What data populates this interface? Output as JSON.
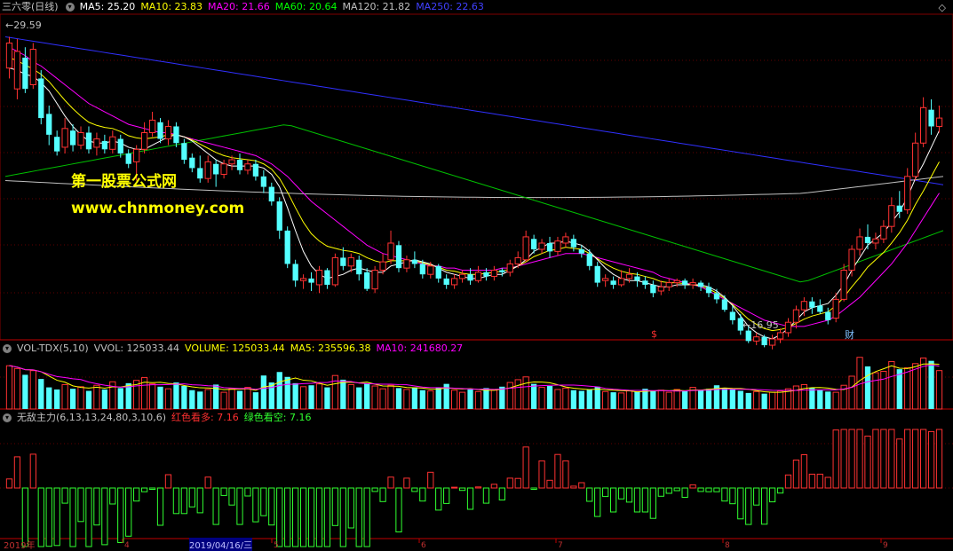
{
  "header": {
    "stock_title": "三六零(日线)",
    "ma5": "MA5: 25.20",
    "ma10": "MA10: 23.83",
    "ma20": "MA20: 21.66",
    "ma60": "MA60: 20.64",
    "ma120": "MA120: 21.82",
    "ma250": "MA250: 22.63",
    "colors": {
      "ma5": "#ffffff",
      "ma10": "#ffff00",
      "ma20": "#ff00ff",
      "ma60": "#00ff00",
      "ma120": "#c0c0c0",
      "ma250": "#4040ff"
    }
  },
  "price_panel": {
    "high_label": "29.59",
    "low_label": "16.95",
    "watermark_title": "第一股票公式网",
    "watermark_url": "www.chnmoney.com",
    "marker_s": "$",
    "marker_cai": "财",
    "corner_icon": "diamond-icon"
  },
  "volume_panel": {
    "title": "VOL-TDX(5,10)",
    "vvol": "VVOL: 125033.44",
    "volume": "VOLUME: 125033.44",
    "ma5": "MA5: 235596.38",
    "ma10": "MA10: 241680.27"
  },
  "indicator_panel": {
    "title": "无敌主力(6,13,13,24,80,3,10,6)",
    "red_label": "红色看多: 7.16",
    "green_label": "绿色看空: 7.16"
  },
  "date_axis": {
    "year_label": "2019年",
    "cursor_date": "2019/04/16/三",
    "ticks": [
      "4",
      "5",
      "6",
      "7",
      "8",
      "9"
    ]
  },
  "chart_data": {
    "type": "candlestick",
    "price_range": [
      15,
      30.5
    ],
    "candles": [
      [
        28,
        29.2,
        29.5,
        27.5
      ],
      [
        27,
        28.8,
        29.4,
        26.5
      ],
      [
        28.5,
        27,
        29,
        26.8
      ],
      [
        27.2,
        28.9,
        29.2,
        27
      ],
      [
        27.5,
        25.6,
        27.9,
        25.3
      ],
      [
        25.8,
        24.8,
        26.2,
        24.3
      ],
      [
        24.7,
        24,
        25,
        23.8
      ],
      [
        24.2,
        25.1,
        25.6,
        23.9
      ],
      [
        25,
        24.3,
        25.3,
        24
      ],
      [
        24.3,
        24.9,
        25.2,
        24.1
      ],
      [
        24.9,
        24.1,
        25.2,
        23.9
      ],
      [
        24.2,
        24.6,
        24.9,
        23.8
      ],
      [
        24.5,
        24.1,
        24.8,
        23.9
      ],
      [
        24.1,
        24.7,
        25,
        23.9
      ],
      [
        24.6,
        23.9,
        24.8,
        23.7
      ],
      [
        23.9,
        23.4,
        24.1,
        23.2
      ],
      [
        23.5,
        24.1,
        24.3,
        22.6
      ],
      [
        24.1,
        24.9,
        25.4,
        23.9
      ],
      [
        24.9,
        25.5,
        25.9,
        24.7
      ],
      [
        25.4,
        24.6,
        25.6,
        24.4
      ],
      [
        24.6,
        25.2,
        25.5,
        24.3
      ],
      [
        25.2,
        24.4,
        25.4,
        24.2
      ],
      [
        24.4,
        23.6,
        24.6,
        23.4
      ],
      [
        23.7,
        23.2,
        23.9,
        23
      ],
      [
        23.2,
        22.7,
        23.8,
        22.5
      ],
      [
        22.7,
        23.5,
        23.8,
        22.5
      ],
      [
        23.4,
        22.9,
        23.6,
        22.3
      ],
      [
        22.9,
        23.4,
        23.6,
        22.7
      ],
      [
        23.4,
        23.6,
        23.8,
        23.1
      ],
      [
        23.6,
        23.1,
        23.9,
        22.9
      ],
      [
        23.1,
        23.4,
        23.6,
        22.9
      ],
      [
        23.4,
        22.8,
        23.6,
        22.6
      ],
      [
        22.8,
        22.3,
        23.1,
        22
      ],
      [
        22.3,
        21.6,
        22.5,
        21.4
      ],
      [
        21.6,
        20.2,
        21.8,
        19.8
      ],
      [
        20.2,
        18.6,
        20.4,
        18.4
      ],
      [
        18.6,
        17.8,
        18.8,
        17.5
      ],
      [
        17.8,
        17.9,
        18.1,
        17.4
      ],
      [
        17.9,
        17.7,
        18.2,
        17.3
      ],
      [
        17.6,
        18.3,
        18.5,
        17.2
      ],
      [
        18.3,
        17.6,
        18.4,
        17.4
      ],
      [
        17.6,
        18.9,
        19.1,
        17.5
      ],
      [
        18.9,
        18.5,
        19.4,
        18.3
      ],
      [
        18.5,
        18.9,
        19.1,
        18.2
      ],
      [
        18.8,
        18.1,
        19,
        17.8
      ],
      [
        18.2,
        17.4,
        18.4,
        17.3
      ],
      [
        17.4,
        18.3,
        18.5,
        17.2
      ],
      [
        18.3,
        18.7,
        19.1,
        18.1
      ],
      [
        18.8,
        19.6,
        20.2,
        18.6
      ],
      [
        19.5,
        18.4,
        19.7,
        18.2
      ],
      [
        18.4,
        18.8,
        19,
        18.2
      ],
      [
        18.8,
        18.6,
        19.2,
        18.4
      ],
      [
        18.6,
        18.1,
        18.8,
        17.9
      ],
      [
        18.1,
        18.5,
        18.7,
        17.9
      ],
      [
        18.5,
        17.9,
        18.6,
        17.7
      ],
      [
        17.9,
        17.6,
        18.1,
        17.4
      ],
      [
        17.6,
        17.9,
        18.1,
        17.4
      ],
      [
        17.9,
        18.1,
        18.3,
        17.7
      ],
      [
        18.1,
        17.8,
        18.4,
        17.6
      ],
      [
        17.8,
        18.2,
        18.5,
        17.7
      ],
      [
        18.2,
        18,
        18.4,
        17.8
      ],
      [
        18,
        18.3,
        18.5,
        17.8
      ],
      [
        18.3,
        18.2,
        18.4,
        18
      ],
      [
        18.2,
        18.6,
        18.8,
        18
      ],
      [
        18.6,
        18.9,
        19.2,
        18.4
      ],
      [
        18.8,
        19.9,
        20.2,
        18.7
      ],
      [
        19.8,
        19.3,
        20,
        19.1
      ],
      [
        19.3,
        19.6,
        19.8,
        19.1
      ],
      [
        19.6,
        19.2,
        19.9,
        18.9
      ],
      [
        19.2,
        19.7,
        19.9,
        19
      ],
      [
        19.6,
        19.9,
        20.1,
        19.4
      ],
      [
        19.8,
        19.4,
        20,
        19.2
      ],
      [
        19.3,
        19.1,
        19.5,
        18.9
      ],
      [
        19.1,
        18.5,
        19.3,
        18.3
      ],
      [
        18.5,
        17.7,
        18.7,
        17.5
      ],
      [
        17.8,
        17.9,
        18.1,
        17.5
      ],
      [
        17.8,
        17.6,
        18,
        17.4
      ],
      [
        17.6,
        17.9,
        18.3,
        17.5
      ],
      [
        17.9,
        18.1,
        18.4,
        17.7
      ],
      [
        18,
        17.8,
        18.2,
        17.5
      ],
      [
        17.8,
        17.6,
        18,
        17.4
      ],
      [
        17.6,
        17.2,
        17.8,
        17
      ],
      [
        17.3,
        17.5,
        17.8,
        17.1
      ],
      [
        17.5,
        17.7,
        17.9,
        17.3
      ],
      [
        17.7,
        17.8,
        17.9,
        17.5
      ],
      [
        17.8,
        17.6,
        17.9,
        17.4
      ],
      [
        17.6,
        17.7,
        17.9,
        17.4
      ],
      [
        17.7,
        17.5,
        17.8,
        17.3
      ],
      [
        17.5,
        17.2,
        17.7,
        17
      ],
      [
        17.2,
        16.9,
        17.4,
        16.7
      ],
      [
        16.9,
        16.4,
        17.1,
        16.3
      ],
      [
        16.3,
        15.9,
        16.6,
        15.7
      ],
      [
        16,
        15.4,
        16.2,
        15.2
      ],
      [
        15.4,
        14.9,
        15.6,
        14.8
      ],
      [
        14.9,
        15.1,
        15.3,
        14.7
      ],
      [
        15.1,
        14.7,
        15.2,
        14.6
      ],
      [
        14.7,
        15,
        15.2,
        14.5
      ],
      [
        15,
        15.3,
        15.5,
        14.8
      ],
      [
        15.3,
        15.8,
        16,
        15.1
      ],
      [
        15.8,
        16.4,
        16.6,
        15.5
      ],
      [
        16.4,
        16.8,
        17,
        16.1
      ],
      [
        16.8,
        16.5,
        17,
        16.2
      ],
      [
        16.6,
        16.3,
        16.9,
        16.2
      ],
      [
        16.3,
        15.9,
        16.5,
        15.7
      ],
      [
        16,
        16.9,
        17.2,
        15.8
      ],
      [
        16.9,
        18.3,
        18.6,
        16.8
      ],
      [
        18.3,
        19.3,
        19.5,
        18
      ],
      [
        19.3,
        19.9,
        20.3,
        19
      ],
      [
        19.9,
        19.6,
        20.5,
        19.3
      ],
      [
        19.6,
        19.8,
        20.1,
        19.3
      ],
      [
        19.8,
        20.4,
        20.7,
        19.6
      ],
      [
        20.4,
        21.4,
        21.8,
        20.1
      ],
      [
        21.4,
        21.1,
        22.1,
        20.8
      ],
      [
        21.2,
        22.8,
        23.2,
        21
      ],
      [
        22.8,
        24.4,
        24.9,
        22.6
      ],
      [
        24.4,
        26.1,
        26.6,
        24.2
      ],
      [
        26,
        25.2,
        26.5,
        24.8
      ],
      [
        25.2,
        25.6,
        26.2,
        24.9
      ]
    ],
    "ma": {
      "ma5": [
        28,
        27.9,
        27.7,
        27.6,
        27.3,
        26.9,
        26.3,
        25.7,
        25.2,
        24.8,
        24.5,
        24.4,
        24.4,
        24.5,
        24.4,
        24.2,
        24.1,
        24.1,
        24.3,
        24.5,
        24.7,
        24.8,
        24.7,
        24.5,
        24.2,
        23.9,
        23.6,
        23.4,
        23.3,
        23.3,
        23.3,
        23.3,
        23.2,
        22.9,
        22.3,
        21.3,
        20.2,
        19.2,
        18.5,
        18.1,
        17.9,
        18,
        18.1,
        18.3,
        18.4,
        18.3,
        18.2,
        18.2,
        18.5,
        18.6,
        18.7,
        18.8,
        18.7,
        18.6,
        18.4,
        18.2,
        18.1,
        18,
        17.9,
        17.9,
        18,
        18.1,
        18.1,
        18.3,
        18.5,
        18.8,
        19.2,
        19.4,
        19.6,
        19.6,
        19.7,
        19.6,
        19.5,
        19.2,
        18.8,
        18.4,
        18.1,
        17.9,
        17.8,
        17.8,
        17.7,
        17.6,
        17.5,
        17.5,
        17.6,
        17.6,
        17.6,
        17.6,
        17.5,
        17.3,
        17,
        16.6,
        16.1,
        15.6,
        15.3,
        15.1,
        15,
        15.2,
        15.5,
        15.9,
        16.3,
        16.5,
        16.6,
        16.7,
        17.1,
        17.6,
        18.3,
        18.9,
        19.5,
        19.8,
        20.1,
        20.6,
        21.1,
        21.8,
        22.7,
        23.4,
        24.2,
        25
      ],
      "ma20": [
        29,
        28.8,
        28.6,
        28.3,
        28.1,
        27.8,
        27.5,
        27.2,
        26.9,
        26.6,
        26.3,
        26.1,
        25.9,
        25.7,
        25.5,
        25.3,
        25.2,
        25.1,
        25,
        24.9,
        24.9,
        24.8,
        24.7,
        24.6,
        24.5,
        24.4,
        24.3,
        24.2,
        24.1,
        24,
        23.9,
        23.8,
        23.6,
        23.4,
        23.1,
        22.8,
        22.4,
        22,
        21.6,
        21.3,
        21,
        20.7,
        20.4,
        20.1,
        19.8,
        19.5,
        19.3,
        19.1,
        19,
        18.9,
        18.8,
        18.7,
        18.6,
        18.5,
        18.5,
        18.4,
        18.4,
        18.3,
        18.3,
        18.3,
        18.3,
        18.3,
        18.4,
        18.4,
        18.5,
        18.6,
        18.7,
        18.8,
        18.9,
        19,
        19.1,
        19.1,
        19.1,
        19,
        18.9,
        18.8,
        18.7,
        18.6,
        18.5,
        18.4,
        18.3,
        18.2,
        18,
        17.9,
        17.8,
        17.7,
        17.6,
        17.5,
        17.3,
        17.1,
        16.9,
        16.7,
        16.5,
        16.3,
        16.1,
        15.9,
        15.8,
        15.7,
        15.6,
        15.6,
        15.6,
        15.7,
        15.8,
        15.9,
        16.1,
        16.4,
        16.7,
        17,
        17.4,
        17.8,
        18.2,
        18.6,
        19.1,
        19.6,
        20.2,
        20.8,
        21.4,
        22
      ]
    },
    "volume": [
      6.2,
      5.8,
      4.9,
      5.5,
      4.3,
      3.1,
      2.8,
      3.5,
      2.9,
      3.2,
      2.6,
      3.4,
      2.8,
      3.9,
      3,
      3.7,
      4.1,
      4.5,
      3.6,
      3.2,
      2.9,
      3.8,
      3.3,
      2.7,
      2.5,
      2.8,
      3.5,
      2.4,
      2.9,
      2.6,
      3.1,
      2.4,
      4.8,
      3.8,
      5.3,
      4.6,
      3.7,
      3.2,
      3.4,
      3.6,
      3.1,
      4.8,
      4.2,
      3.5,
      3.1,
      3.7,
      3.3,
      2.9,
      3.4,
      3,
      2.8,
      3.1,
      2.7,
      2.6,
      3.1,
      3.6,
      2.7,
      2.4,
      2.8,
      2.5,
      3,
      2.7,
      3.2,
      3.8,
      4.2,
      4.6,
      3.6,
      3.1,
      3.3,
      2.8,
      3,
      2.7,
      2.6,
      2.8,
      3.2,
      2.5,
      2.4,
      2.3,
      2.6,
      2.5,
      2.9,
      2.6,
      2.7,
      2.4,
      2.8,
      2.6,
      3.1,
      2.7,
      2.9,
      3.4,
      3,
      2.8,
      2.6,
      2.3,
      2.5,
      2.2,
      2.4,
      2.6,
      2.9,
      3.3,
      3.5,
      3,
      2.7,
      2.5,
      2.4,
      3.4,
      4.7,
      7.4,
      6.1,
      5.2,
      5.4,
      6.8,
      5.7,
      5.9,
      6.5,
      7.3,
      6.9,
      5.5
    ]
  }
}
